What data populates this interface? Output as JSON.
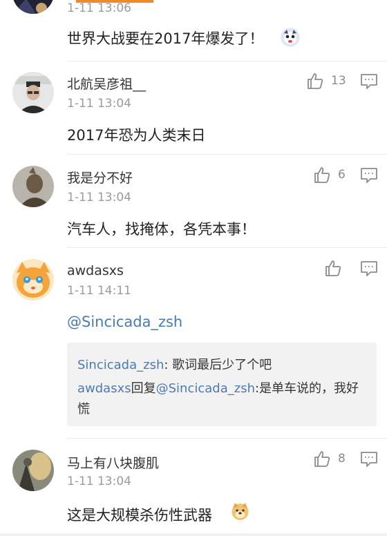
{
  "colors": {
    "accent": "#f08a24",
    "link": "#4a7bb0",
    "quote_bg": "#f2f2f2"
  },
  "comment0": {
    "time": "1-11 13:06",
    "text": "世界大战要在2017年爆发了！",
    "emoji": "sticker-face-emoji"
  },
  "comment1": {
    "name": "北航吴彦祖__",
    "time": "1-11 13:04",
    "likes": "13",
    "text": "2017年恐为人类末日"
  },
  "comment2": {
    "name": "我是分不好",
    "time": "1-11 13:04",
    "likes": "6",
    "text": "汽车人，找掩体，各凭本事！"
  },
  "comment3": {
    "name": "awdasxs",
    "time": "1-11 14:11",
    "text": "@Sincicada_zsh",
    "quote": {
      "line1_user": "Sincicada_zsh",
      "line1_text": ": 歌词最后少了个吧",
      "line2_user": "awdasxs",
      "line2_mid": "回复",
      "line2_mention": "@Sincicada_zsh",
      "line2_text": ":是单车说的，我好慌"
    }
  },
  "comment4": {
    "name": "马上有八块腹肌",
    "time": "1-11 13:04",
    "likes": "8",
    "text": "这是大规模杀伤性武器",
    "emoji": "doge-emoji"
  }
}
